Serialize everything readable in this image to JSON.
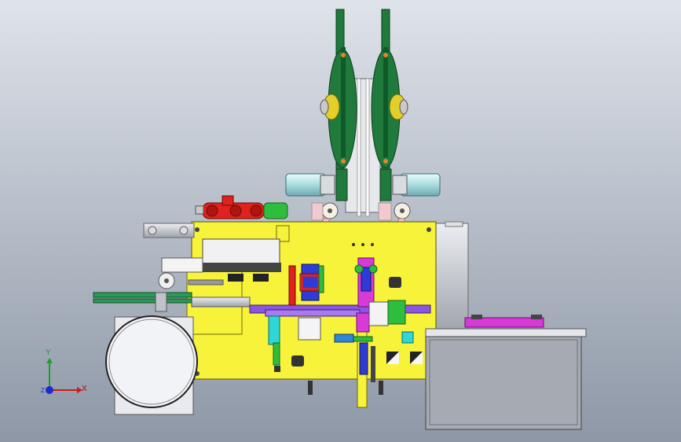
{
  "viewport": {
    "background_top": "#dfe3ea",
    "background_bottom": "#8d97a6"
  },
  "colors": {
    "frame_yellow": "#f7f23a",
    "wheel_green": "#1f7a3b",
    "shaft_cyan": "#a9dbe0",
    "part_red": "#e0221c",
    "part_blue": "#2f3bd6",
    "part_magenta": "#d83ad8",
    "part_purple": "#8a55e0",
    "metal_gray": "#b9bcc4",
    "bin_gray": "#9ea2aa"
  },
  "triad": {
    "x_label": "X",
    "y_label": "Y",
    "z_label": "Z",
    "x_color": "#d11a1a",
    "y_color": "#1aa12a",
    "z_color": "#1a2ad1"
  }
}
